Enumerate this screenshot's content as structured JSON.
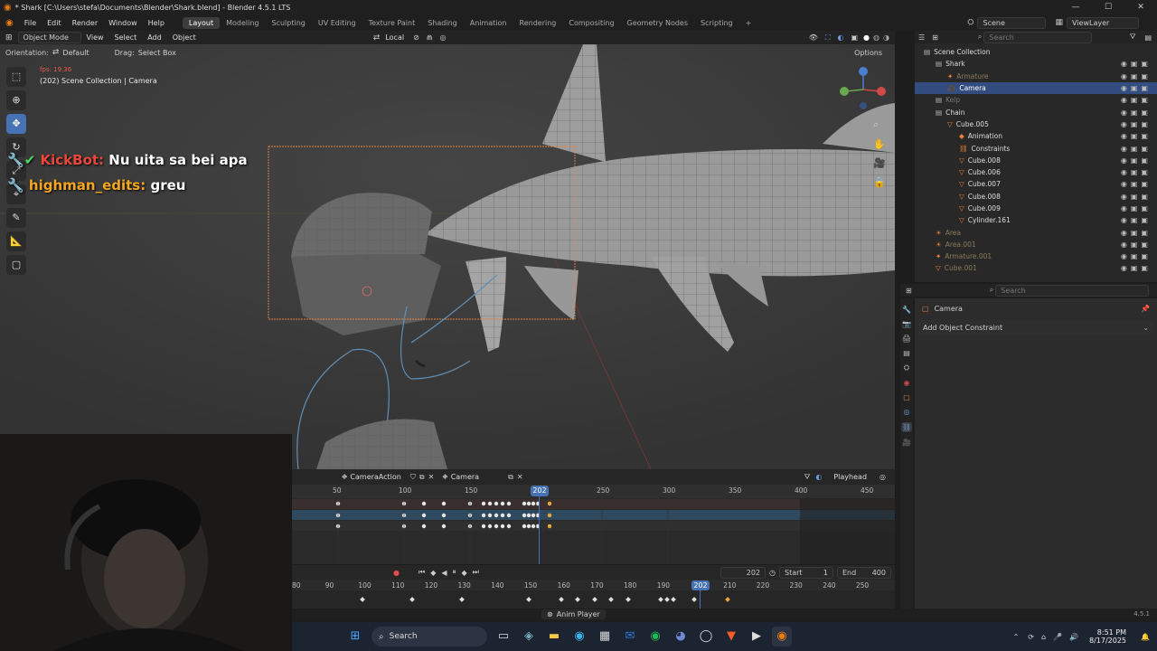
{
  "window": {
    "title": "* Shark [C:\\Users\\stefa\\Documents\\Blender\\Shark.blend] - Blender 4.5.1 LTS",
    "controls": [
      "—",
      "☐",
      "✕"
    ]
  },
  "menubar": {
    "menus": [
      "File",
      "Edit",
      "Render",
      "Window",
      "Help"
    ],
    "workspaces": [
      "Layout",
      "Modeling",
      "Sculpting",
      "UV Editing",
      "Texture Paint",
      "Shading",
      "Animation",
      "Rendering",
      "Compositing",
      "Geometry Nodes",
      "Scripting"
    ],
    "active_workspace": "Layout",
    "add_tab": "+",
    "scene": "Scene",
    "view_layer": "ViewLayer"
  },
  "viewport_header": {
    "mode": "Object Mode",
    "menus": [
      "View",
      "Select",
      "Add",
      "Object"
    ],
    "transform_orientation": "Local",
    "orientation_label": "Orientation:",
    "orientation_value": "Default",
    "drag_label": "Drag:",
    "drag_value": "Select Box",
    "options": "Options"
  },
  "viewport": {
    "fps": "fps: 19.36",
    "info": "(202) Scene Collection | Camera"
  },
  "chat": {
    "messages": [
      {
        "user": "KickBot:",
        "text": "Nu uita sa bei apa",
        "user_color": "#e8473a"
      },
      {
        "user": "highman_edits:",
        "text": "greu",
        "user_color": "#f6a623"
      }
    ]
  },
  "dopesheet": {
    "action": "CameraAction",
    "object": "Camera",
    "playhead_mode": "Playhead",
    "current_frame": "202",
    "ruler": [
      "50",
      "100",
      "150",
      "250",
      "300",
      "350",
      "400",
      "450"
    ]
  },
  "timeline": {
    "current_frame": "202",
    "start_label": "Start",
    "start": "1",
    "end_label": "End",
    "end": "400",
    "ruler": [
      "80",
      "90",
      "100",
      "110",
      "120",
      "130",
      "140",
      "150",
      "160",
      "170",
      "180",
      "190",
      "210",
      "220",
      "230",
      "240",
      "250"
    ]
  },
  "outliner": {
    "search_placeholder": "Search",
    "rows": [
      {
        "label": "Scene Collection",
        "indent": 0,
        "color": "#ddd",
        "icon": "▤"
      },
      {
        "label": "Shark",
        "indent": 1,
        "color": "#ddd",
        "icon": "▤"
      },
      {
        "label": "Armature",
        "indent": 2,
        "color": "#8a7a5a",
        "icon": "✦"
      },
      {
        "label": "Camera",
        "indent": 2,
        "color": "#fff",
        "icon": "🎥",
        "selected": true
      },
      {
        "label": "Kelp",
        "indent": 1,
        "color": "#777",
        "icon": "▤"
      },
      {
        "label": "Chain",
        "indent": 1,
        "color": "#ddd",
        "icon": "▤"
      },
      {
        "label": "Cube.005",
        "indent": 2,
        "color": "#ddd",
        "icon": "▽"
      },
      {
        "label": "Animation",
        "indent": 3,
        "color": "#ddd",
        "icon": "◆"
      },
      {
        "label": "Constraints",
        "indent": 3,
        "color": "#ddd",
        "icon": "⛓"
      },
      {
        "label": "Cube.008",
        "indent": 3,
        "color": "#ddd",
        "icon": "▽"
      },
      {
        "label": "Cube.006",
        "indent": 3,
        "color": "#ddd",
        "icon": "▽"
      },
      {
        "label": "Cube.007",
        "indent": 3,
        "color": "#ddd",
        "icon": "▽"
      },
      {
        "label": "Cube.008",
        "indent": 3,
        "color": "#ddd",
        "icon": "▽"
      },
      {
        "label": "Cube.009",
        "indent": 3,
        "color": "#ddd",
        "icon": "▽"
      },
      {
        "label": "Cylinder.161",
        "indent": 3,
        "color": "#ddd",
        "icon": "▽"
      },
      {
        "label": "Area",
        "indent": 1,
        "color": "#8a7a5a",
        "icon": "☀"
      },
      {
        "label": "Area.001",
        "indent": 1,
        "color": "#8a7a5a",
        "icon": "☀"
      },
      {
        "label": "Armature.001",
        "indent": 1,
        "color": "#8a7a5a",
        "icon": "✦"
      },
      {
        "label": "Cube.001",
        "indent": 1,
        "color": "#8a7a5a",
        "icon": "▽"
      }
    ]
  },
  "properties": {
    "search_placeholder": "Search",
    "object_name": "Camera",
    "add_constraint": "Add Object Constraint"
  },
  "status": {
    "anim_player": "Anim Player",
    "version": "4.5.1"
  },
  "taskbar": {
    "search": "Search",
    "time": "8:51 PM",
    "date": "8/17/2025"
  }
}
